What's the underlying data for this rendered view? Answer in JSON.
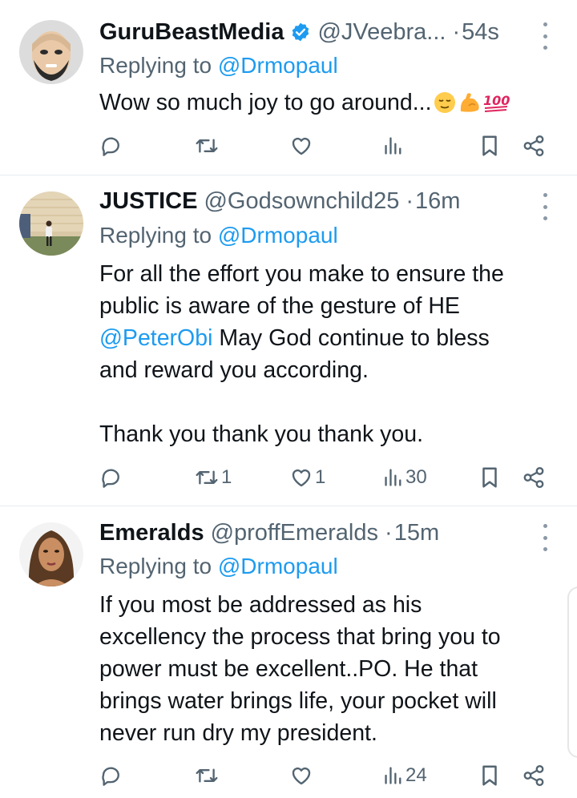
{
  "tweets": [
    {
      "name": "GuruBeastMedia",
      "verified": true,
      "handle": "@JVeebra...",
      "time": "54s",
      "replying_label": "Replying to",
      "replying_to": "@Drmopaul",
      "body_line1": "Wow so much joy to go around...",
      "retweets": "",
      "likes": "",
      "views": ""
    },
    {
      "name": "JUSTICE",
      "verified": false,
      "handle": "@Godsownchild25",
      "time": "16m",
      "replying_label": "Replying to",
      "replying_to": "@Drmopaul",
      "body_line1": "For all the effort you make to ensure the",
      "body_line2": "public is aware of the gesture of HE",
      "body_mention": "@PeterObi",
      "body_line3_rest": " May God continue to bless",
      "body_line4": "and reward you according.",
      "body_line5": "Thank you thank you thank you.",
      "retweets": "1",
      "likes": "1",
      "views": "30"
    },
    {
      "name": "Emeralds",
      "verified": false,
      "handle": "@proffEmeralds",
      "time": "15m",
      "replying_label": "Replying to",
      "replying_to": "@Drmopaul",
      "body_line1": "If you most be addressed as his",
      "body_line2": "excellency the process that bring you to",
      "body_line3": "power must be excellent..PO. He that",
      "body_line4": "brings water brings life, your pocket will",
      "body_line5": "never run dry my president.",
      "retweets": "",
      "likes": "",
      "views": "24"
    }
  ],
  "separator_dot": "·",
  "emoji_names": [
    "relieved-face",
    "flexed-biceps",
    "hundred-points"
  ],
  "colors": {
    "accent": "#1d9bf0",
    "muted": "#536471",
    "text": "#0f1419",
    "divider": "#e6ecf0"
  }
}
